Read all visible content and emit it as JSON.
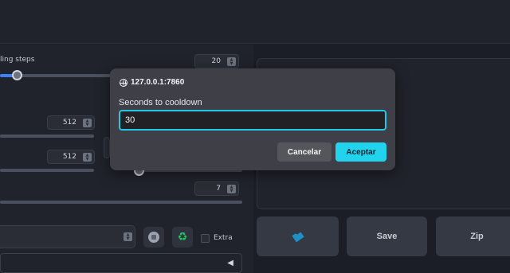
{
  "background": {
    "sampling_steps_label": "ling steps",
    "sampling_steps_value": "20",
    "width_value": "512",
    "height_value": "512",
    "batch_value": "7",
    "extra_label": "Extra",
    "collapse_arrow": "◀",
    "spin_up": "▲",
    "spin_down": "▼",
    "recycle_glyph": "♻"
  },
  "actions": {
    "save_label": "Save",
    "zip_label": "Zip"
  },
  "dialog": {
    "host": "127.0.0.1:7860",
    "message": "Seconds to cooldown",
    "input_value": "30",
    "cancel_label": "Cancelar",
    "accept_label": "Aceptar"
  },
  "colors": {
    "accent": "#22d3ee",
    "slider_fill": "#3b82f6",
    "recycle": "#22c55e",
    "folder": "#1e90c8"
  },
  "icons": [
    "globe-icon",
    "dice-icon",
    "recycle-icon",
    "folder-icon",
    "spinner-icon",
    "chevron-left-icon"
  ]
}
